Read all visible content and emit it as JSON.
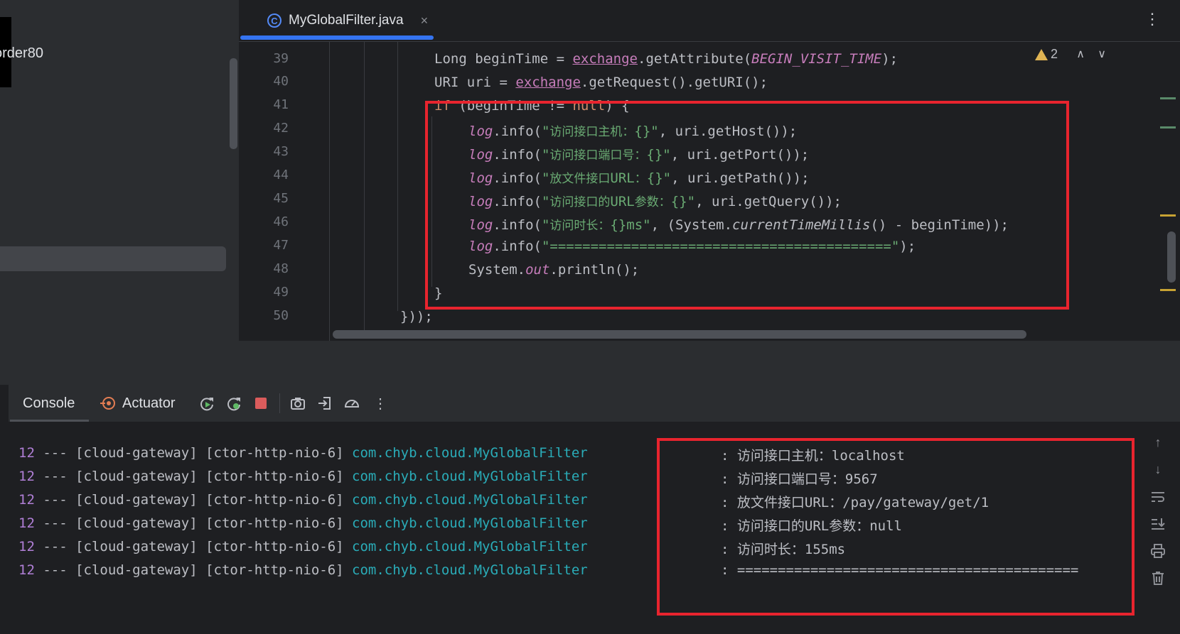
{
  "sidebar": {
    "project_name": "order80"
  },
  "editor": {
    "tab": {
      "icon": "C",
      "label": "MyGlobalFilter.java",
      "close": "×"
    },
    "more": "⋮",
    "problems": {
      "warning_count": "2"
    },
    "line_numbers": [
      "39",
      "40",
      "41",
      "42",
      "43",
      "44",
      "45",
      "46",
      "47",
      "48",
      "49",
      "50"
    ],
    "code": {
      "l39_type": "Long",
      "l39_var": " beginTime = ",
      "l39_obj": "exchange",
      "l39_call": ".getAttribute(",
      "l39_const": "BEGIN_VISIT_TIME",
      "l39_end": ");",
      "l40_type": "URI",
      "l40_var": " uri = ",
      "l40_obj": "exchange",
      "l40_call": ".getRequest().getURI();",
      "l41_kw": "if",
      "l41_mid": " (beginTime != ",
      "l41_null": "null",
      "l41_end": ") {",
      "log": "log",
      "l42_a": ".info(",
      "l42_s1": "\"",
      "l42_zh": "访问接口主机：",
      "l42_s2": "{}\"",
      "l42_end": ", uri.getHost());",
      "l43_a": ".info(",
      "l43_s1": "\"",
      "l43_zh": "访问接口端口号：",
      "l43_s2": "{}\"",
      "l43_end": ", uri.getPort());",
      "l44_a": ".info(",
      "l44_s1": "\"",
      "l44_zh": "放文件接口",
      "l44_s2": "URL",
      "l44_zh2": "：",
      "l44_s3": "{}\"",
      "l44_end": ", uri.getPath());",
      "l45_a": ".info(",
      "l45_s1": "\"",
      "l45_zh": "访问接口的",
      "l45_s2": "URL",
      "l45_zh2": "参数：",
      "l45_s3": "{}\"",
      "l45_end": ", uri.getQuery());",
      "l46_a": ".info(",
      "l46_s1": "\"",
      "l46_zh": "访问时长：",
      "l46_s2": "{}ms\"",
      "l46_mid": ", (System.",
      "l46_it": "currentTimeMillis",
      "l46_end": "() - beginTime));",
      "l47_a": ".info(",
      "l47_s": "\"==========================================\"",
      "l47_end": ");",
      "l48_a": "System.",
      "l48_out": "out",
      "l48_end": ".println();",
      "l49": "}",
      "l50": "}));"
    }
  },
  "console": {
    "tabs": {
      "console": "Console",
      "actuator": "Actuator"
    },
    "more": "⋮",
    "rows": [
      {
        "pid": "12",
        "mid": " --- [cloud-gateway] [ctor-http-nio-6] ",
        "logger": "com.chyb.cloud.MyGlobalFilter",
        "msg_prefix": ": ",
        "msg": "访问接口主机：localhost"
      },
      {
        "pid": "12",
        "mid": " --- [cloud-gateway] [ctor-http-nio-6] ",
        "logger": "com.chyb.cloud.MyGlobalFilter",
        "msg_prefix": ": ",
        "msg": "访问接口端口号：9567"
      },
      {
        "pid": "12",
        "mid": " --- [cloud-gateway] [ctor-http-nio-6] ",
        "logger": "com.chyb.cloud.MyGlobalFilter",
        "msg_prefix": ": ",
        "msg": "放文件接口URL：/pay/gateway/get/1"
      },
      {
        "pid": "12",
        "mid": " --- [cloud-gateway] [ctor-http-nio-6] ",
        "logger": "com.chyb.cloud.MyGlobalFilter",
        "msg_prefix": ": ",
        "msg": "访问接口的URL参数：null"
      },
      {
        "pid": "12",
        "mid": " --- [cloud-gateway] [ctor-http-nio-6] ",
        "logger": "com.chyb.cloud.MyGlobalFilter",
        "msg_prefix": ": ",
        "msg": "访问时长：155ms"
      },
      {
        "pid": "12",
        "mid": " --- [cloud-gateway] [ctor-http-nio-6] ",
        "logger": "com.chyb.cloud.MyGlobalFilter",
        "msg_prefix": ": ",
        "msg": "=========================================="
      }
    ]
  },
  "colors": {
    "highlight": "#e8242e",
    "accent": "#3574f0",
    "logger": "#2aacb8",
    "warning": "#e0b453"
  }
}
